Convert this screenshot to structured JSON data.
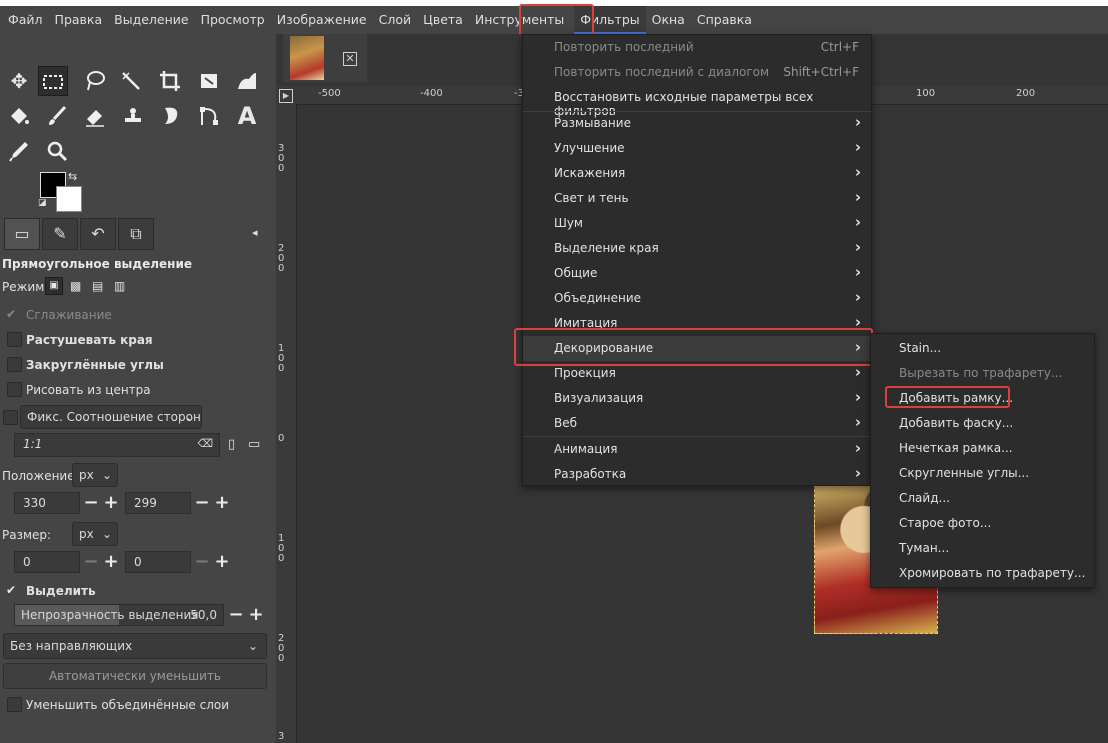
{
  "menubar": {
    "items": [
      "Файл",
      "Правка",
      "Выделение",
      "Просмотр",
      "Изображение",
      "Слой",
      "Цвета",
      "Инструменты",
      "Фильтры",
      "Окна",
      "Справка"
    ]
  },
  "tool_options": {
    "title": "Прямоугольное выделение",
    "mode_label": "Режим:",
    "antialias": "Сглаживание",
    "feather": "Растушевать края",
    "rounded": "Закруглённые углы",
    "from_center": "Рисовать из центра",
    "fixed": "Фикс. Соотношение сторон",
    "ratio": "1:1",
    "position_label": "Положение:",
    "position_unit": "px",
    "pos_x": "330",
    "pos_y": "299",
    "size_label": "Размер:",
    "size_unit": "px",
    "size_w": "0",
    "size_h": "0",
    "highlight": "Выделить",
    "opacity_label": "Непрозрачность выделения",
    "opacity_value": "50,0",
    "opacity_fraction": 0.5,
    "guides": "Без направляющих",
    "autoshrink": "Автоматически уменьшить",
    "shrink_merged": "Уменьшить объединённые слои"
  },
  "ruler": {
    "h": [
      "-500",
      "-400",
      "-3",
      "100",
      "200"
    ],
    "v": [
      "3\n0\n0",
      "2\n0\n0",
      "1\n0\n0",
      "0",
      "1\n0\n0",
      "2\n0\n0",
      "3"
    ]
  },
  "filters_menu": {
    "items": [
      {
        "label": "Повторить последний",
        "shortcut": "Ctrl+F",
        "disabled": true
      },
      {
        "label": "Повторить последний с диалогом",
        "shortcut": "Shift+Ctrl+F",
        "disabled": true
      },
      {
        "label": "Восстановить исходные параметры всех фильтров"
      },
      {
        "label": "Размывание",
        "sub": true
      },
      {
        "label": "Улучшение",
        "sub": true
      },
      {
        "label": "Искажения",
        "sub": true
      },
      {
        "label": "Свет и тень",
        "sub": true
      },
      {
        "label": "Шум",
        "sub": true
      },
      {
        "label": "Выделение края",
        "sub": true
      },
      {
        "label": "Общие",
        "sub": true
      },
      {
        "label": "Объединение",
        "sub": true
      },
      {
        "label": "Имитация",
        "sub": true
      },
      {
        "label": "Декорирование",
        "sub": true,
        "highlighted": true
      },
      {
        "label": "Проекция",
        "sub": true
      },
      {
        "label": "Визуализация",
        "sub": true
      },
      {
        "label": "Веб",
        "sub": true
      },
      {
        "label": "Анимация",
        "sub": true
      },
      {
        "label": "Разработка",
        "sub": true
      }
    ]
  },
  "decor_submenu": {
    "items": [
      {
        "label": "Stain..."
      },
      {
        "label": "Вырезать по трафарету...",
        "disabled": true
      },
      {
        "label": "Добавить рамку..."
      },
      {
        "label": "Добавить фаску..."
      },
      {
        "label": "Нечеткая рамка..."
      },
      {
        "label": "Скругленные углы..."
      },
      {
        "label": "Слайд..."
      },
      {
        "label": "Старое фото..."
      },
      {
        "label": "Туман..."
      },
      {
        "label": "Хромировать по трафарету..."
      }
    ]
  },
  "colors": {
    "highlight_box": "#d9423a",
    "menu_bg": "#2c2c2c",
    "canvas_bg": "#353535"
  }
}
